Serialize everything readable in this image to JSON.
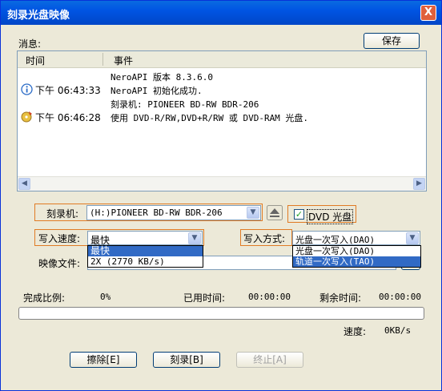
{
  "window": {
    "title": "刻录光盘映像",
    "close_symbol": "X"
  },
  "messages": {
    "label": "消息:",
    "save_label": "保存",
    "columns": {
      "time": "时间",
      "event": "事件"
    },
    "rows": [
      {
        "icon": "",
        "time": "",
        "message": "NeroAPI 版本 8.3.6.0"
      },
      {
        "icon": "info-icon",
        "time": "下午 06:43:33",
        "message": "NeroAPI 初始化成功."
      },
      {
        "icon": "",
        "time": "",
        "message": "刻录机: PIONEER  BD-RW   BDR-206"
      },
      {
        "icon": "disc-icon",
        "time": "下午 06:46:28",
        "message": "使用 DVD-R/RW,DVD+R/RW 或 DVD-RAM 光盘."
      }
    ]
  },
  "recorder": {
    "label": "刻录机:",
    "value": "(H:)PIONEER  BD-RW   BDR-206",
    "dvd_label": "DVD 光盘",
    "dvd_checked": true
  },
  "write_speed": {
    "label": "写入速度:",
    "value": "最快",
    "options": [
      "最快",
      "2X (2770 KB/s)"
    ]
  },
  "write_method": {
    "label": "写入方式:",
    "value": "光盘一次写入(DAO)",
    "options": [
      "光盘一次写入(DAO)",
      "轨道一次写入(TAO)"
    ]
  },
  "image_file": {
    "label": "映像文件:"
  },
  "progress": {
    "completion_label": "完成比例:",
    "completion_value": "0%",
    "elapsed_label": "已用时间:",
    "elapsed_value": "00:00:00",
    "remaining_label": "剩余时间:",
    "remaining_value": "00:00:00",
    "fraction": 0,
    "speed_label": "速度:",
    "speed_value": "0KB/s"
  },
  "buttons": {
    "erase": "擦除[E]",
    "burn": "刻录[B]",
    "stop": "终止[A]"
  },
  "colors": {
    "title_bar": "#0054e3",
    "highlight_border": "#e07b24",
    "selection": "#316ac5"
  }
}
